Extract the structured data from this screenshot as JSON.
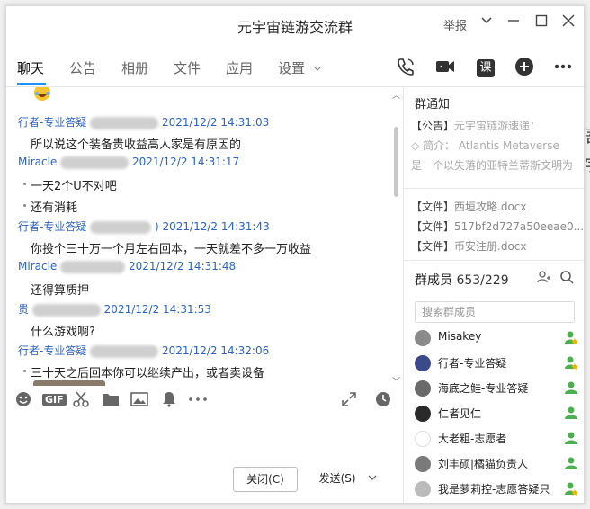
{
  "window": {
    "title": "元宇宙链游交流群",
    "report_label": "举报"
  },
  "tabs": [
    {
      "label": "聊天",
      "active": true
    },
    {
      "label": "公告"
    },
    {
      "label": "相册"
    },
    {
      "label": "文件"
    },
    {
      "label": "应用"
    },
    {
      "label": "设置"
    }
  ],
  "toolbar_icons": [
    "phone-icon",
    "video-call-icon",
    "lesson-icon",
    "add-icon",
    "more-icon"
  ],
  "lesson_label": "课",
  "messages": [
    {
      "sender": "行者-专业答疑",
      "time": "2021/12/2 14:31:03",
      "lines": [
        "所以说这个装备贵收益高人家是有原因的"
      ]
    },
    {
      "sender": "Miracle",
      "time": "2021/12/2 14:31:17",
      "lines": [
        "一天2个U不对吧",
        "还有消耗"
      ]
    },
    {
      "sender": "行者-专业答疑",
      "time": ") 2021/12/2 14:31:43",
      "lines": [
        "你投个三十万一个月左右回本，一天就差不多一万收益"
      ]
    },
    {
      "sender": "Miracle",
      "time": "2021/12/2 14:31:48",
      "lines": [
        "还得算质押"
      ]
    },
    {
      "sender": "贵",
      "time": "2021/12/2 14:31:53",
      "lines": [
        "什么游戏啊?"
      ]
    },
    {
      "sender": "行者-专业答疑",
      "time": "2021/12/2 14:32:06",
      "lines": [
        "三十天之后回本你可以继续产出，或者卖设备"
      ]
    }
  ],
  "input_toolbar": {
    "gif_label": "GIF",
    "close_button": "关闭(C)",
    "send_button": "发送(S)"
  },
  "group_notice": {
    "title": "群通知",
    "announcement_label": "【公告】",
    "announcement_text": "元宇宙链游速递：",
    "intro_label": "◇ 简介：",
    "intro_text": "Atlantis Metaverse",
    "intro_text2": "是一个以失落的亚特兰蒂斯文明为"
  },
  "files": [
    {
      "label": "【文件】",
      "name": "西垣攻略.docx"
    },
    {
      "label": "【文件】",
      "name": "517bf2d727a50eeae0..."
    },
    {
      "label": "【文件】",
      "name": "币安注册.docx"
    }
  ],
  "members": {
    "title": "群成员",
    "count": "653/229",
    "search_placeholder": "搜索群成员",
    "list": [
      {
        "name": "Misakey",
        "color": "#8a8a8a",
        "badge": "#f0b400"
      },
      {
        "name": "行者-专业答疑",
        "color": "#3a4a8a",
        "badge": "#f0b400"
      },
      {
        "name": "海底之鲑-专业答疑",
        "color": "#6a6a6a",
        "badge": "#4caf50"
      },
      {
        "name": "仁者见仁",
        "color": "#2a2a2a",
        "badge": "#4caf50"
      },
      {
        "name": "大老粗-志愿者",
        "color": "#9a9a9a",
        "badge": "#4caf50"
      },
      {
        "name": "刘丰硕|橘猫负责人",
        "color": "#7a7a7a",
        "badge": "#4caf50"
      },
      {
        "name": "我是萝莉控-志愿答疑只",
        "color": "#bbbbbb",
        "badge": "#f0b400"
      }
    ]
  }
}
